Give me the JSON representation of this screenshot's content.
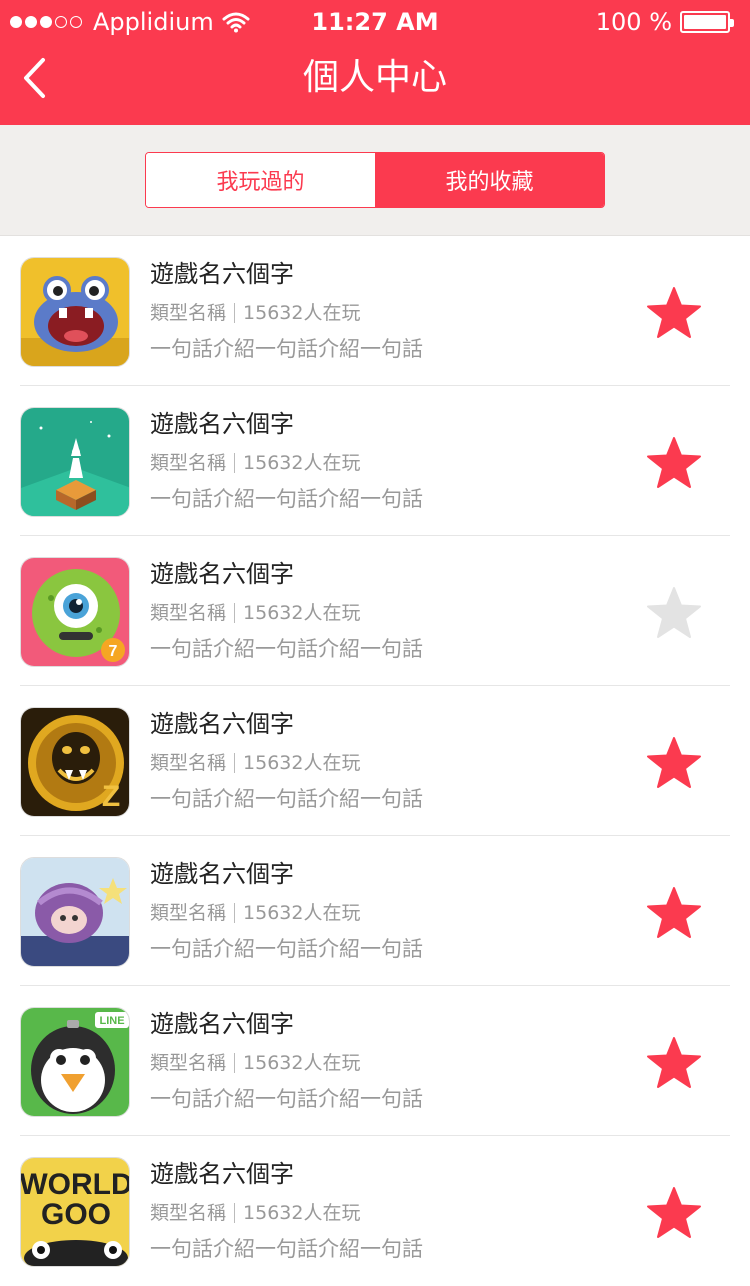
{
  "status_bar": {
    "carrier": "Applidium",
    "time": "11:27 AM",
    "battery": "100 %"
  },
  "nav": {
    "title": "個人中心"
  },
  "tabs": [
    {
      "label": "我玩過的",
      "active": false
    },
    {
      "label": "我的收藏",
      "active": true
    }
  ],
  "colors": {
    "accent": "#fb3a4f",
    "star_on": "#fb3a4f",
    "star_off": "#e3e3e3"
  },
  "games": [
    {
      "name": "遊戲名六個字",
      "category": "類型名稱",
      "players": "15632人在玩",
      "description": "一句話介紹一句話介紹一句話",
      "favorited": true,
      "icon": "yellow-monster-icon"
    },
    {
      "name": "遊戲名六個字",
      "category": "類型名稱",
      "players": "15632人在玩",
      "description": "一句話介紹一句話介紹一句話",
      "favorited": true,
      "icon": "monument-valley-icon"
    },
    {
      "name": "遊戲名六個字",
      "category": "類型名稱",
      "players": "15632人在玩",
      "description": "一句話介紹一句話介紹一句話",
      "favorited": false,
      "icon": "green-eyeball-monster-icon"
    },
    {
      "name": "遊戲名六個字",
      "category": "類型名稱",
      "players": "15632人在玩",
      "description": "一句話介紹一句話介紹一句話",
      "favorited": true,
      "icon": "temple-run-icon"
    },
    {
      "name": "遊戲名六個字",
      "category": "類型名稱",
      "players": "15632人在玩",
      "description": "一句話介紹一句話介紹一句話",
      "favorited": true,
      "icon": "purple-creature-icon"
    },
    {
      "name": "遊戲名六個字",
      "category": "類型名稱",
      "players": "15632人在玩",
      "description": "一句話介紹一句話介紹一句話",
      "favorited": true,
      "icon": "line-penguin-icon"
    },
    {
      "name": "遊戲名六個字",
      "category": "類型名稱",
      "players": "15632人在玩",
      "description": "一句話介紹一句話介紹一句話",
      "favorited": true,
      "icon": "world-of-goo-icon"
    }
  ]
}
